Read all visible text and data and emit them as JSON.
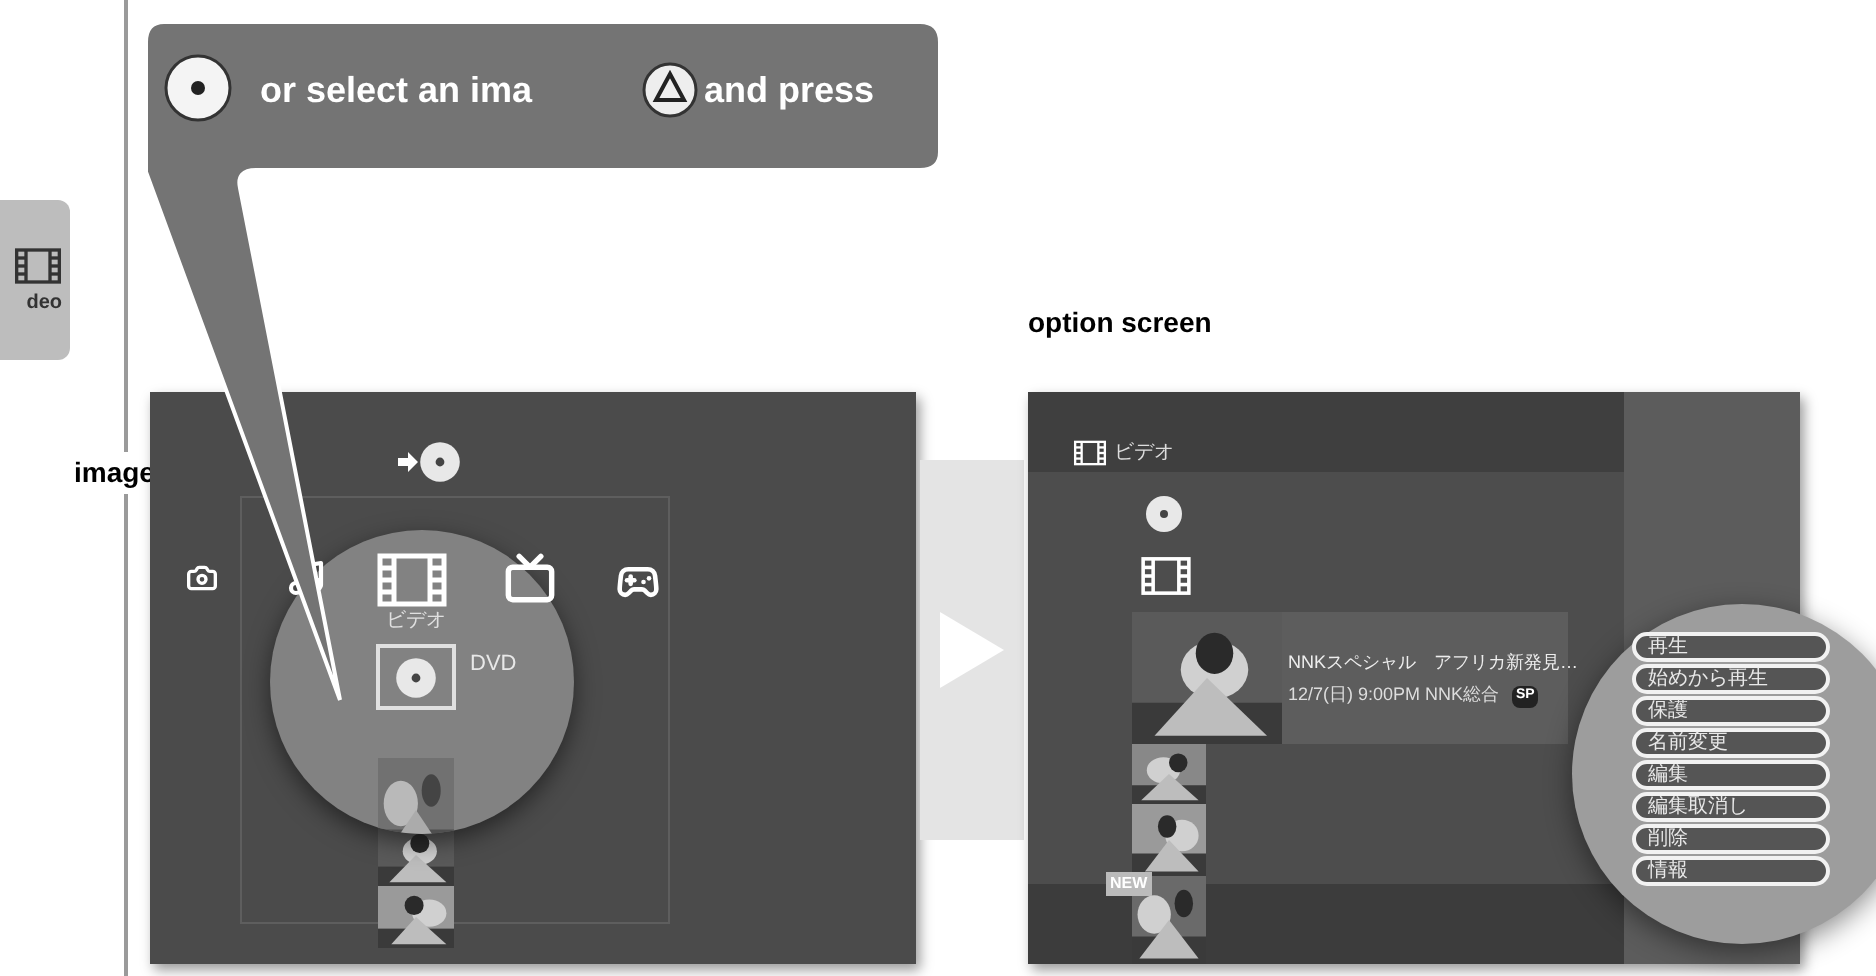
{
  "sidebar_tab": {
    "label": "deo"
  },
  "callout": {
    "text_start": "or select an ima",
    "text_end": "and press"
  },
  "caption_left": "image",
  "caption_right": "option screen",
  "xmb_screen": {
    "category_label": "ビデオ",
    "disc_label": "DVD"
  },
  "option_screen": {
    "header": "ビデオ",
    "title": "NNKスペシャル　アフリカ新発見…",
    "subtitle": "12/7(日) 9:00PM NNK総合",
    "badge": "SP",
    "new_badge": "NEW",
    "menu": [
      "再生",
      "始めから再生",
      "保護",
      "名前変更",
      "編集",
      "編集取消し",
      "削除",
      "情報"
    ]
  }
}
